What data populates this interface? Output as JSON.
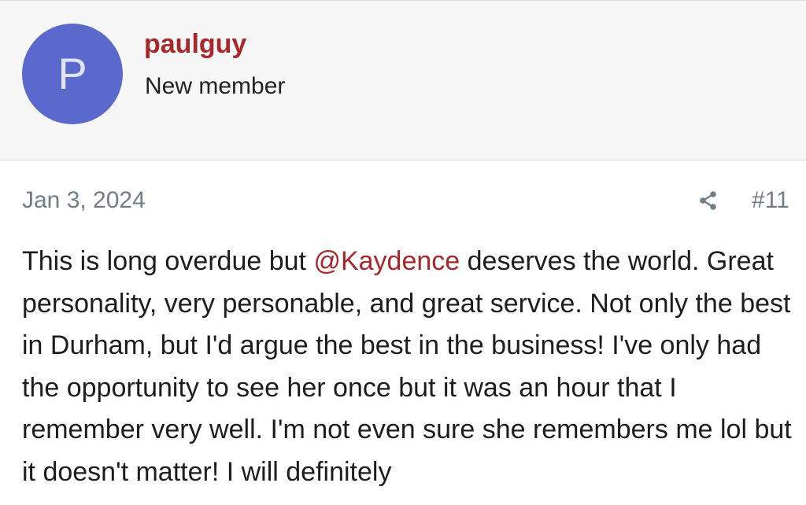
{
  "user": {
    "avatar_letter": "P",
    "name": "paulguy",
    "title": "New member",
    "avatar_color": "#5b68cc",
    "name_color": "#a9262a"
  },
  "post": {
    "date": "Jan 3, 2024",
    "number": "#11",
    "share_icon": "share-icon",
    "body_before": "This is long overdue but ",
    "mention": "@Kaydence",
    "body_after": " deserves the world. Great personality, very personable, and great service. Not only the best in Durham, but I'd argue the best in the business! I've only had the opportunity to see her once but it was an hour that I remember very well. I'm not even sure she remembers me lol but it doesn't matter! I will definitely"
  }
}
